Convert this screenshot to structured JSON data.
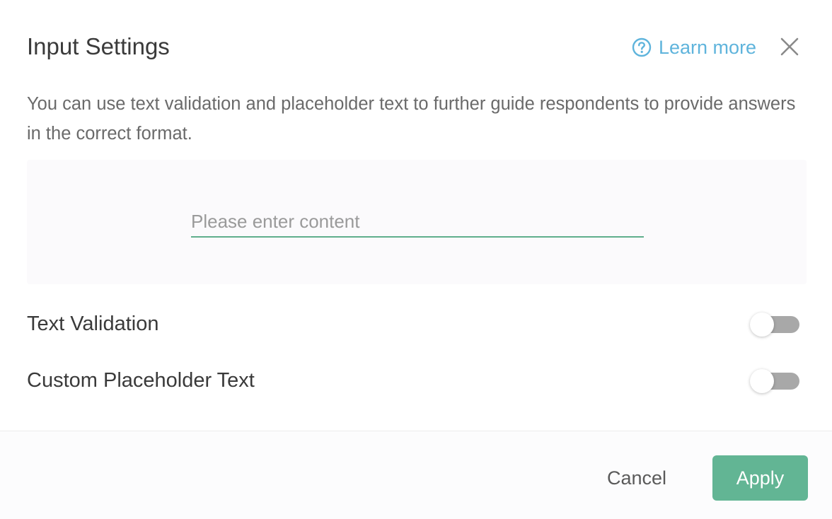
{
  "dialog": {
    "title": "Input Settings",
    "learn_more_label": "Learn more",
    "description": "You can use text validation and placeholder text to further guide respondents to provide answers in the correct format."
  },
  "preview": {
    "input_value": "",
    "input_placeholder": "Please enter content"
  },
  "settings": [
    {
      "label": "Text Validation",
      "enabled": false
    },
    {
      "label": "Custom Placeholder Text",
      "enabled": false
    }
  ],
  "footer": {
    "cancel_label": "Cancel",
    "apply_label": "Apply"
  },
  "icons": {
    "help": "question-circle-icon",
    "close": "close-icon"
  },
  "colors": {
    "accent": "#62b594",
    "link": "#5fb4dc",
    "toggle_off": "#a8a8a8"
  }
}
